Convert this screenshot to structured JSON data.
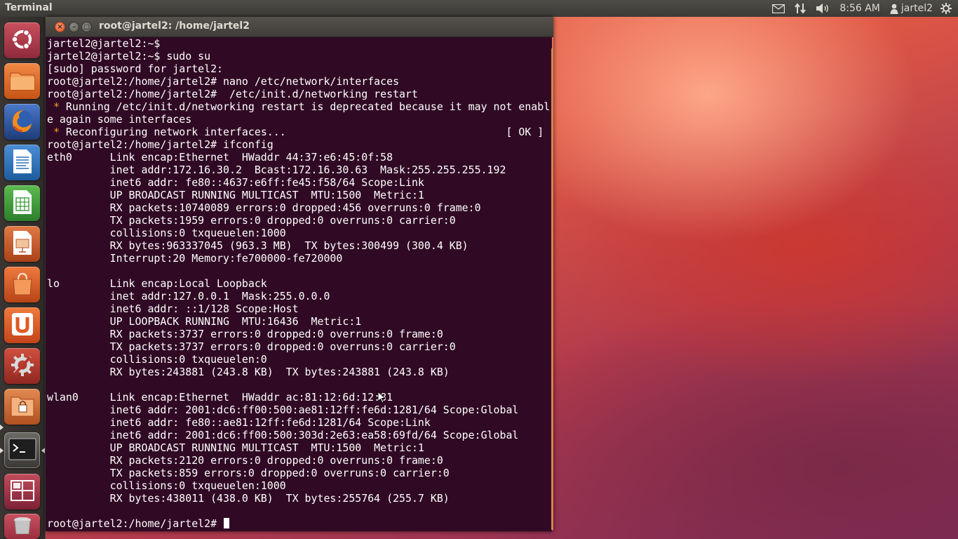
{
  "top_panel": {
    "app_title": "Terminal",
    "clock": "8:56 AM",
    "user": "jartel2",
    "icons": [
      "mail-icon",
      "network-icon",
      "volume-icon",
      "user-icon",
      "power-gear-icon"
    ]
  },
  "launcher": {
    "items": [
      {
        "name": "dash-home",
        "icon": "ubuntu-logo-icon",
        "color": "#b03a4a"
      },
      {
        "name": "files",
        "icon": "folder-icon",
        "color": "#e0672a"
      },
      {
        "name": "firefox",
        "icon": "firefox-icon",
        "color": "#2f5ea8"
      },
      {
        "name": "libreoffice-writer",
        "icon": "writer-icon",
        "color": "#2c6fb6"
      },
      {
        "name": "libreoffice-calc",
        "icon": "calc-icon",
        "color": "#3a9a3a"
      },
      {
        "name": "libreoffice-impress",
        "icon": "impress-icon",
        "color": "#c0562c"
      },
      {
        "name": "software-center",
        "icon": "shopping-bag-icon",
        "color": "#d9582b"
      },
      {
        "name": "ubuntu-one",
        "icon": "ubuntu-one-icon",
        "color": "#e05a24"
      },
      {
        "name": "system-settings",
        "icon": "settings-tools-icon",
        "color": "#b83a2f"
      },
      {
        "name": "files-secure",
        "icon": "file-lock-icon",
        "color": "#cf6a35"
      },
      {
        "name": "terminal",
        "icon": "terminal-icon",
        "color": "#4a4a46"
      },
      {
        "name": "workspace-switcher",
        "icon": "workspace-icon",
        "color": "#a43048"
      },
      {
        "name": "trash",
        "icon": "trash-icon",
        "color": "#b8424f"
      }
    ]
  },
  "window": {
    "title": "root@jartel2: /home/jartel2",
    "close_glyph": "×",
    "min_glyph": "–",
    "max_glyph": "□"
  },
  "terminal": {
    "lines": [
      "jartel2@jartel2:~$",
      "jartel2@jartel2:~$ sudo su",
      "[sudo] password for jartel2:",
      "root@jartel2:/home/jartel2# nano /etc/network/interfaces",
      "root@jartel2:/home/jartel2#  /etc/init.d/networking restart",
      " * Running /etc/init.d/networking restart is deprecated because it may not enabl",
      "e again some interfaces",
      " * Reconfiguring network interfaces...                                   [ OK ]",
      "root@jartel2:/home/jartel2# ifconfig",
      "eth0      Link encap:Ethernet  HWaddr 44:37:e6:45:0f:58",
      "          inet addr:172.16.30.2  Bcast:172.16.30.63  Mask:255.255.255.192",
      "          inet6 addr: fe80::4637:e6ff:fe45:f58/64 Scope:Link",
      "          UP BROADCAST RUNNING MULTICAST  MTU:1500  Metric:1",
      "          RX packets:10740089 errors:0 dropped:456 overruns:0 frame:0",
      "          TX packets:1959 errors:0 dropped:0 overruns:0 carrier:0",
      "          collisions:0 txqueuelen:1000",
      "          RX bytes:963337045 (963.3 MB)  TX bytes:300499 (300.4 KB)",
      "          Interrupt:20 Memory:fe700000-fe720000",
      "",
      "lo        Link encap:Local Loopback",
      "          inet addr:127.0.0.1  Mask:255.0.0.0",
      "          inet6 addr: ::1/128 Scope:Host",
      "          UP LOOPBACK RUNNING  MTU:16436  Metric:1",
      "          RX packets:3737 errors:0 dropped:0 overruns:0 frame:0",
      "          TX packets:3737 errors:0 dropped:0 overruns:0 carrier:0",
      "          collisions:0 txqueuelen:0",
      "          RX bytes:243881 (243.8 KB)  TX bytes:243881 (243.8 KB)",
      "",
      "wlan0     Link encap:Ethernet  HWaddr ac:81:12:6d:12:81",
      "          inet6 addr: 2001:dc6:ff00:500:ae81:12ff:fe6d:1281/64 Scope:Global",
      "          inet6 addr: fe80::ae81:12ff:fe6d:1281/64 Scope:Link",
      "          inet6 addr: 2001:dc6:ff00:500:303d:2e63:ea58:69fd/64 Scope:Global",
      "          UP BROADCAST RUNNING MULTICAST  MTU:1500  Metric:1",
      "          RX packets:2120 errors:0 dropped:0 overruns:0 frame:0",
      "          TX packets:859 errors:0 dropped:0 overruns:0 carrier:0",
      "          collisions:0 txqueuelen:1000",
      "          RX bytes:438011 (438.0 KB)  TX bytes:255764 (255.7 KB)",
      ""
    ],
    "prompt": "root@jartel2:/home/jartel2# ",
    "colors": {
      "background": "#300a24",
      "text": "#ffffff",
      "bullet": "#ef9b2c"
    }
  }
}
